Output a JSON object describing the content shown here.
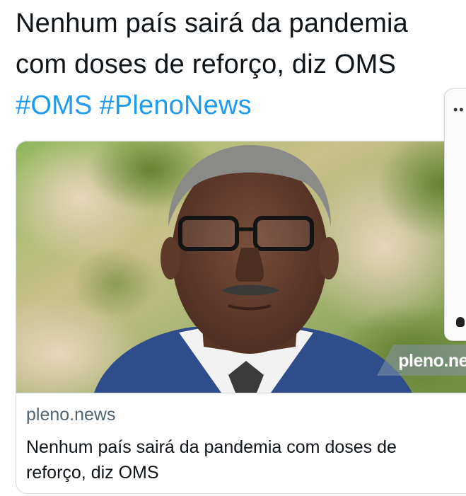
{
  "tweet": {
    "text_line1": "Nenhum país sairá da pandemia",
    "text_line2": "com doses de reforço, diz OMS",
    "hashtags": [
      "#OMS",
      "#PlenoNews"
    ]
  },
  "card": {
    "domain": "pleno.news",
    "title_line1": "Nenhum país sairá da pandemia com doses de",
    "title_line2": "reforço, diz OMS",
    "image_watermark": "pleno.new"
  },
  "colors": {
    "text": "#0f1419",
    "hashtag": "#1d9bf0",
    "secondary": "#536471",
    "border": "#cfd9de"
  },
  "icons": {
    "edge_panel": "more-dots-icon"
  }
}
